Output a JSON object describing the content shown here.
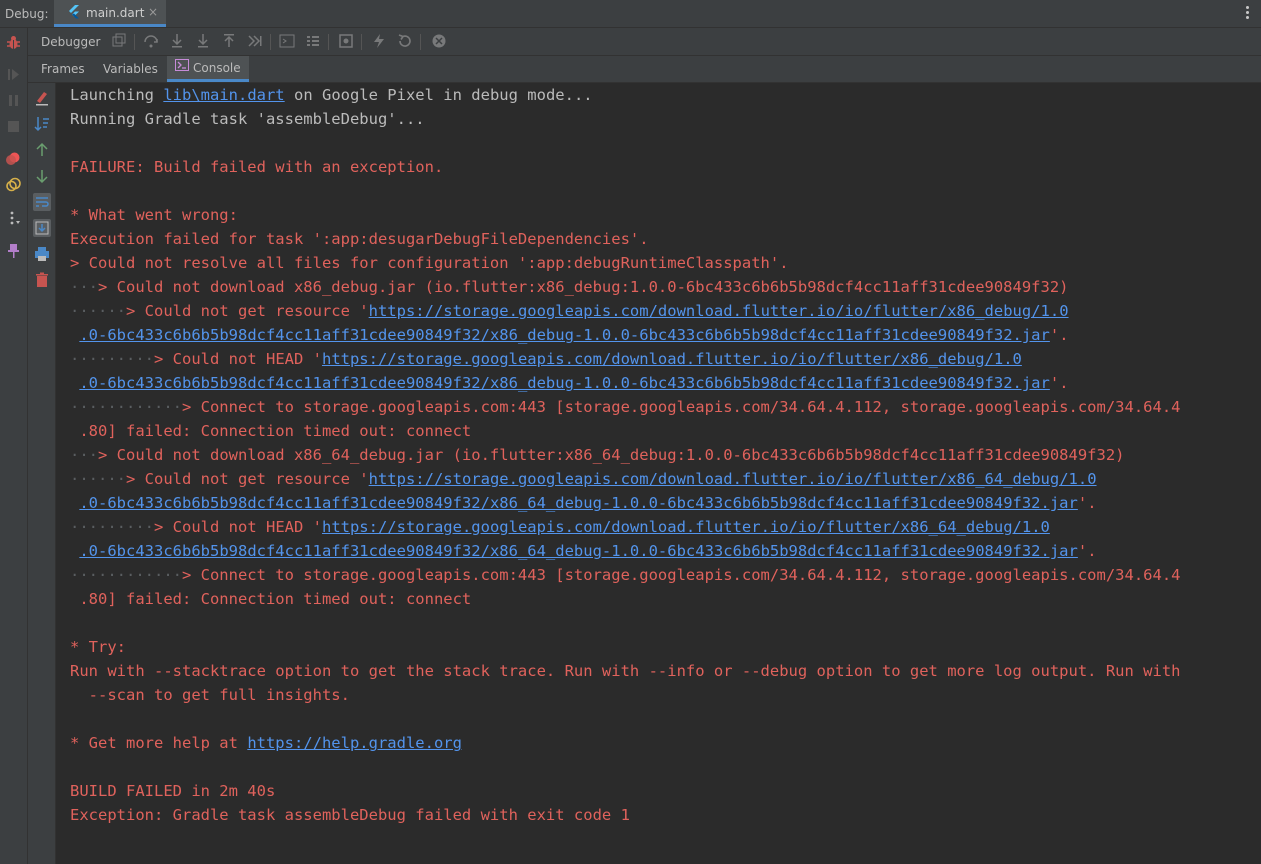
{
  "topbar": {
    "debug_label": "Debug:",
    "file_tab": "main.dart",
    "close": "×"
  },
  "toolbar": {
    "debugger_label": "Debugger"
  },
  "subtabs": {
    "frames": "Frames",
    "variables": "Variables",
    "console": "Console"
  },
  "colors": {
    "error": "#e0625c",
    "link": "#5394ec",
    "text": "#bbbbbb",
    "accent": "#4a88c7"
  },
  "icons": {
    "left_strip": [
      "debug-bug-icon",
      "resume-icon",
      "pause-icon",
      "stop-icon",
      "view-breakpoints-icon",
      "mute-breakpoints-icon",
      "more-icon",
      "pin-icon"
    ],
    "toolbar": [
      "restore-layout-icon",
      "step-over-icon",
      "step-into-icon",
      "force-step-into-icon",
      "step-out-icon",
      "run-to-cursor-icon",
      "evaluate-expression-icon",
      "trace-icon",
      "screenshot-icon",
      "hot-reload-icon",
      "hot-restart-icon",
      "open-devtools-icon"
    ],
    "console_strip": [
      "clear-all-icon",
      "scroll-to-end-icon",
      "up-arrow-icon",
      "down-arrow-icon",
      "soft-wrap-icon",
      "scroll-to-bottom-icon",
      "print-icon",
      "trash-icon"
    ]
  },
  "console": {
    "lines": [
      {
        "cls": "normal",
        "segments": [
          {
            "t": "Launching "
          },
          {
            "t": "lib\\main.dart",
            "link": true
          },
          {
            "t": " on Google Pixel in debug mode..."
          }
        ]
      },
      {
        "cls": "normal",
        "segments": [
          {
            "t": "Running Gradle task 'assembleDebug'..."
          }
        ]
      },
      {
        "cls": "normal",
        "segments": [
          {
            "t": ""
          }
        ]
      },
      {
        "cls": "err",
        "segments": [
          {
            "t": "FAILURE: Build failed with an exception."
          }
        ]
      },
      {
        "cls": "err",
        "segments": [
          {
            "t": ""
          }
        ]
      },
      {
        "cls": "err",
        "segments": [
          {
            "t": "* What went wrong:"
          }
        ]
      },
      {
        "cls": "err",
        "segments": [
          {
            "t": "Execution failed for task ':app:desugarDebugFileDependencies'."
          }
        ]
      },
      {
        "cls": "err",
        "segments": [
          {
            "t": "> Could not resolve all files for configuration ':app:debugRuntimeClasspath'."
          }
        ]
      },
      {
        "cls": "err",
        "segments": [
          {
            "t": "···",
            "dots": true
          },
          {
            "t": "> Could not download x86_debug.jar (io.flutter:x86_debug:1.0.0-6bc433c6b6b5b98dcf4cc11aff31cdee90849f32)"
          }
        ]
      },
      {
        "cls": "err",
        "segments": [
          {
            "t": "······",
            "dots": true
          },
          {
            "t": "> Could not get resource '"
          },
          {
            "t": "https://storage.googleapis.com/download.flutter.io/io/flutter/x86_debug/1.0",
            "link": true
          }
        ]
      },
      {
        "cls": "err",
        "segments": [
          {
            "t": " "
          },
          {
            "t": ".0-6bc433c6b6b5b98dcf4cc11aff31cdee90849f32/x86_debug-1.0.0-6bc433c6b6b5b98dcf4cc11aff31cdee90849f32.jar",
            "link": true
          },
          {
            "t": "'."
          }
        ]
      },
      {
        "cls": "err",
        "segments": [
          {
            "t": "·········",
            "dots": true
          },
          {
            "t": "> Could not HEAD '"
          },
          {
            "t": "https://storage.googleapis.com/download.flutter.io/io/flutter/x86_debug/1.0",
            "link": true
          }
        ]
      },
      {
        "cls": "err",
        "segments": [
          {
            "t": " "
          },
          {
            "t": ".0-6bc433c6b6b5b98dcf4cc11aff31cdee90849f32/x86_debug-1.0.0-6bc433c6b6b5b98dcf4cc11aff31cdee90849f32.jar",
            "link": true
          },
          {
            "t": "'."
          }
        ]
      },
      {
        "cls": "err",
        "segments": [
          {
            "t": "············",
            "dots": true
          },
          {
            "t": "> Connect to storage.googleapis.com:443 [storage.googleapis.com/34.64.4.112, storage.googleapis.com/34.64.4"
          }
        ]
      },
      {
        "cls": "err",
        "segments": [
          {
            "t": " .80] failed: Connection timed out: connect"
          }
        ]
      },
      {
        "cls": "err",
        "segments": [
          {
            "t": "···",
            "dots": true
          },
          {
            "t": "> Could not download x86_64_debug.jar (io.flutter:x86_64_debug:1.0.0-6bc433c6b6b5b98dcf4cc11aff31cdee90849f32)"
          }
        ]
      },
      {
        "cls": "err",
        "segments": [
          {
            "t": "······",
            "dots": true
          },
          {
            "t": "> Could not get resource '"
          },
          {
            "t": "https://storage.googleapis.com/download.flutter.io/io/flutter/x86_64_debug/1.0",
            "link": true
          }
        ]
      },
      {
        "cls": "err",
        "segments": [
          {
            "t": " "
          },
          {
            "t": ".0-6bc433c6b6b5b98dcf4cc11aff31cdee90849f32/x86_64_debug-1.0.0-6bc433c6b6b5b98dcf4cc11aff31cdee90849f32.jar",
            "link": true
          },
          {
            "t": "'."
          }
        ]
      },
      {
        "cls": "err",
        "segments": [
          {
            "t": "·········",
            "dots": true
          },
          {
            "t": "> Could not HEAD '"
          },
          {
            "t": "https://storage.googleapis.com/download.flutter.io/io/flutter/x86_64_debug/1.0",
            "link": true
          }
        ]
      },
      {
        "cls": "err",
        "segments": [
          {
            "t": " "
          },
          {
            "t": ".0-6bc433c6b6b5b98dcf4cc11aff31cdee90849f32/x86_64_debug-1.0.0-6bc433c6b6b5b98dcf4cc11aff31cdee90849f32.jar",
            "link": true
          },
          {
            "t": "'."
          }
        ]
      },
      {
        "cls": "err",
        "segments": [
          {
            "t": "············",
            "dots": true
          },
          {
            "t": "> Connect to storage.googleapis.com:443 [storage.googleapis.com/34.64.4.112, storage.googleapis.com/34.64.4"
          }
        ]
      },
      {
        "cls": "err",
        "segments": [
          {
            "t": " .80] failed: Connection timed out: connect"
          }
        ]
      },
      {
        "cls": "err",
        "segments": [
          {
            "t": ""
          }
        ]
      },
      {
        "cls": "err",
        "segments": [
          {
            "t": "* Try:"
          }
        ]
      },
      {
        "cls": "err",
        "segments": [
          {
            "t": "Run with --stacktrace option to get the stack trace. Run with --info or --debug option to get more log output. Run with"
          }
        ]
      },
      {
        "cls": "err",
        "segments": [
          {
            "t": "  --scan to get full insights."
          }
        ]
      },
      {
        "cls": "err",
        "segments": [
          {
            "t": ""
          }
        ]
      },
      {
        "cls": "err",
        "segments": [
          {
            "t": "* Get more help at "
          },
          {
            "t": "https://help.gradle.org",
            "link": true
          }
        ]
      },
      {
        "cls": "err",
        "segments": [
          {
            "t": ""
          }
        ]
      },
      {
        "cls": "err",
        "segments": [
          {
            "t": "BUILD FAILED in 2m 40s"
          }
        ]
      },
      {
        "cls": "err",
        "segments": [
          {
            "t": "Exception: Gradle task assembleDebug failed with exit code 1"
          }
        ]
      }
    ]
  }
}
